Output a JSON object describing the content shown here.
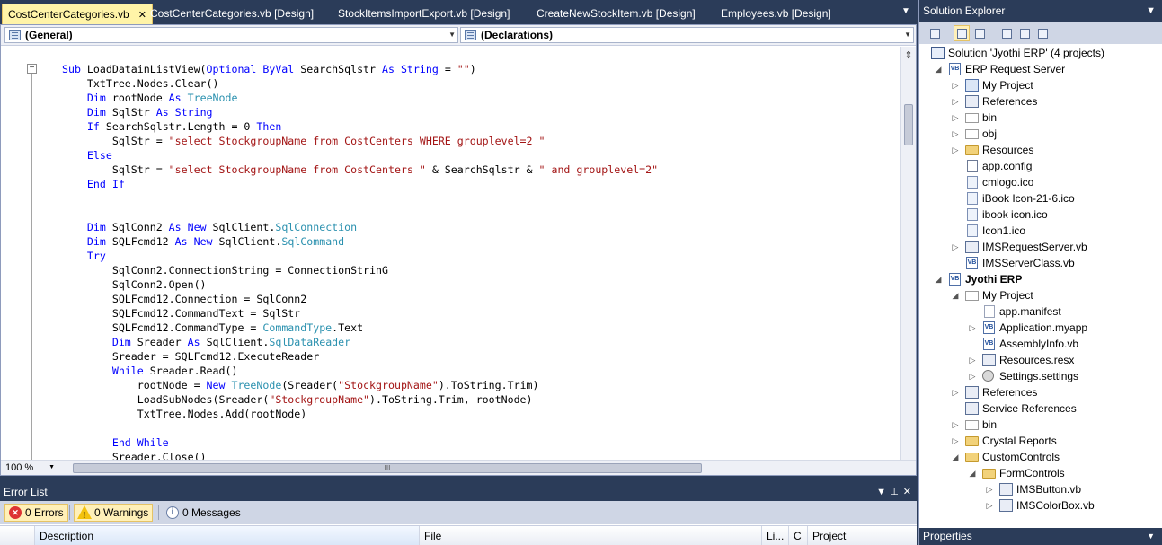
{
  "tabs": [
    {
      "label": "CostCenterCategories.vb",
      "active": true
    },
    {
      "label": "CostCenterCategories.vb [Design]",
      "active": false
    },
    {
      "label": "StockItemsImportExport.vb [Design]",
      "active": false
    },
    {
      "label": "CreateNewStockItem.vb [Design]",
      "active": false
    },
    {
      "label": "Employees.vb [Design]",
      "active": false
    }
  ],
  "editor": {
    "left_combo": "(General)",
    "right_combo": "(Declarations)",
    "zoom": "100 %",
    "code_lines": [
      [
        [
          "kw",
          "Sub "
        ],
        [
          "",
          "LoadDatainListView("
        ],
        [
          "kw",
          "Optional ByVal "
        ],
        [
          "",
          "SearchSqlstr "
        ],
        [
          "kw",
          "As String "
        ],
        [
          "",
          "= "
        ],
        [
          "st",
          "\"\""
        ],
        [
          "",
          ")"
        ]
      ],
      [
        [
          "",
          "    TxtTree.Nodes.Clear()"
        ]
      ],
      [
        [
          "kw",
          "    Dim "
        ],
        [
          "",
          "rootNode "
        ],
        [
          "kw",
          "As "
        ],
        [
          "ty",
          "TreeNode"
        ]
      ],
      [
        [
          "kw",
          "    Dim "
        ],
        [
          "",
          "SqlStr "
        ],
        [
          "kw",
          "As String"
        ]
      ],
      [
        [
          "kw",
          "    If "
        ],
        [
          "",
          "SearchSqlstr.Length = 0 "
        ],
        [
          "kw",
          "Then"
        ]
      ],
      [
        [
          "",
          "        SqlStr = "
        ],
        [
          "st",
          "\"select StockgroupName from CostCenters WHERE grouplevel=2 \""
        ]
      ],
      [
        [
          "kw",
          "    Else"
        ]
      ],
      [
        [
          "",
          "        SqlStr = "
        ],
        [
          "st",
          "\"select StockgroupName from CostCenters \""
        ],
        [
          "",
          " & SearchSqlstr & "
        ],
        [
          "st",
          "\" and grouplevel=2\""
        ]
      ],
      [
        [
          "kw",
          "    End If"
        ]
      ],
      [
        [
          "",
          ""
        ]
      ],
      [
        [
          "",
          ""
        ]
      ],
      [
        [
          "kw",
          "    Dim "
        ],
        [
          "",
          "SqlConn2 "
        ],
        [
          "kw",
          "As New "
        ],
        [
          "",
          "SqlClient."
        ],
        [
          "ty",
          "SqlConnection"
        ]
      ],
      [
        [
          "kw",
          "    Dim "
        ],
        [
          "",
          "SQLFcmd12 "
        ],
        [
          "kw",
          "As New "
        ],
        [
          "",
          "SqlClient."
        ],
        [
          "ty",
          "SqlCommand"
        ]
      ],
      [
        [
          "kw",
          "    Try"
        ]
      ],
      [
        [
          "",
          "        SqlConn2.ConnectionString = ConnectionStrinG"
        ]
      ],
      [
        [
          "",
          "        SqlConn2.Open()"
        ]
      ],
      [
        [
          "",
          "        SQLFcmd12.Connection = SqlConn2"
        ]
      ],
      [
        [
          "",
          "        SQLFcmd12.CommandText = SqlStr"
        ]
      ],
      [
        [
          "",
          "        SQLFcmd12.CommandType = "
        ],
        [
          "ty",
          "CommandType"
        ],
        [
          "",
          ".Text"
        ]
      ],
      [
        [
          "kw",
          "        Dim "
        ],
        [
          "",
          "Sreader "
        ],
        [
          "kw",
          "As "
        ],
        [
          "",
          "SqlClient."
        ],
        [
          "ty",
          "SqlDataReader"
        ]
      ],
      [
        [
          "",
          "        Sreader = SQLFcmd12.ExecuteReader"
        ]
      ],
      [
        [
          "kw",
          "        While "
        ],
        [
          "",
          "Sreader.Read()"
        ]
      ],
      [
        [
          "",
          "            rootNode = "
        ],
        [
          "kw",
          "New "
        ],
        [
          "ty",
          "TreeNode"
        ],
        [
          "",
          "(Sreader("
        ],
        [
          "st",
          "\"StockgroupName\""
        ],
        [
          "",
          ").ToString.Trim)"
        ]
      ],
      [
        [
          "",
          "            LoadSubNodes(Sreader("
        ],
        [
          "st",
          "\"StockgroupName\""
        ],
        [
          "",
          ").ToString.Trim, rootNode)"
        ]
      ],
      [
        [
          "",
          "            TxtTree.Nodes.Add(rootNode)"
        ]
      ],
      [
        [
          "",
          ""
        ]
      ],
      [
        [
          "kw",
          "        End While"
        ]
      ],
      [
        [
          "",
          "        Sreader.Close()"
        ]
      ]
    ]
  },
  "error_list": {
    "title": "Error List",
    "errors": "0 Errors",
    "warnings": "0 Warnings",
    "messages": "0 Messages",
    "columns": [
      "Description",
      "File",
      "Li...",
      "C",
      "Project"
    ]
  },
  "solution_explorer": {
    "title": "Solution Explorer",
    "nodes": [
      {
        "label": "Solution 'Jyothi ERP' (4 projects)",
        "indent": 0,
        "icon": "sol",
        "exp": ""
      },
      {
        "label": "ERP Request Server",
        "indent": 1,
        "icon": "vb",
        "exp": "open"
      },
      {
        "label": "My Project",
        "indent": 2,
        "icon": "proj",
        "exp": "closed"
      },
      {
        "label": "References",
        "indent": 2,
        "icon": "ref",
        "exp": "closed"
      },
      {
        "label": "bin",
        "indent": 2,
        "icon": "folder-w",
        "exp": "closed"
      },
      {
        "label": "obj",
        "indent": 2,
        "icon": "folder-w",
        "exp": "closed"
      },
      {
        "label": "Resources",
        "indent": 2,
        "icon": "folder",
        "exp": "closed"
      },
      {
        "label": "app.config",
        "indent": 2,
        "icon": "cfg",
        "exp": ""
      },
      {
        "label": "cmlogo.ico",
        "indent": 2,
        "icon": "ico",
        "exp": ""
      },
      {
        "label": "iBook Icon-21-6.ico",
        "indent": 2,
        "icon": "ico",
        "exp": ""
      },
      {
        "label": "ibook icon.ico",
        "indent": 2,
        "icon": "ico",
        "exp": ""
      },
      {
        "label": "Icon1.ico",
        "indent": 2,
        "icon": "ico",
        "exp": ""
      },
      {
        "label": "IMSRequestServer.vb",
        "indent": 2,
        "icon": "ref",
        "exp": "closed"
      },
      {
        "label": "IMSServerClass.vb",
        "indent": 2,
        "icon": "vb",
        "exp": ""
      },
      {
        "label": "Jyothi ERP",
        "indent": 1,
        "icon": "vb",
        "exp": "open",
        "bold": true
      },
      {
        "label": "My Project",
        "indent": 2,
        "icon": "folder-w",
        "exp": "open"
      },
      {
        "label": "app.manifest",
        "indent": 3,
        "icon": "file",
        "exp": ""
      },
      {
        "label": "Application.myapp",
        "indent": 3,
        "icon": "vb",
        "exp": "closed"
      },
      {
        "label": "AssemblyInfo.vb",
        "indent": 3,
        "icon": "vb",
        "exp": ""
      },
      {
        "label": "Resources.resx",
        "indent": 3,
        "icon": "ref",
        "exp": "closed"
      },
      {
        "label": "Settings.settings",
        "indent": 3,
        "icon": "gear",
        "exp": "closed"
      },
      {
        "label": "References",
        "indent": 2,
        "icon": "ref",
        "exp": "closed"
      },
      {
        "label": "Service References",
        "indent": 2,
        "icon": "ref",
        "exp": ""
      },
      {
        "label": "bin",
        "indent": 2,
        "icon": "folder-w",
        "exp": "closed"
      },
      {
        "label": "Crystal Reports",
        "indent": 2,
        "icon": "folder",
        "exp": "closed"
      },
      {
        "label": "CustomControls",
        "indent": 2,
        "icon": "folder",
        "exp": "open"
      },
      {
        "label": "FormControls",
        "indent": 3,
        "icon": "folder",
        "exp": "open"
      },
      {
        "label": "IMSButton.vb",
        "indent": 4,
        "icon": "ref",
        "exp": "closed"
      },
      {
        "label": "IMSColorBox.vb",
        "indent": 4,
        "icon": "ref",
        "exp": "closed"
      }
    ]
  },
  "properties": {
    "title": "Properties"
  },
  "colors": {
    "chrome": "#2b3c59",
    "active_tab": "#fff4a8",
    "keyword": "#0000ff",
    "type": "#2b91af",
    "string": "#a31515"
  }
}
